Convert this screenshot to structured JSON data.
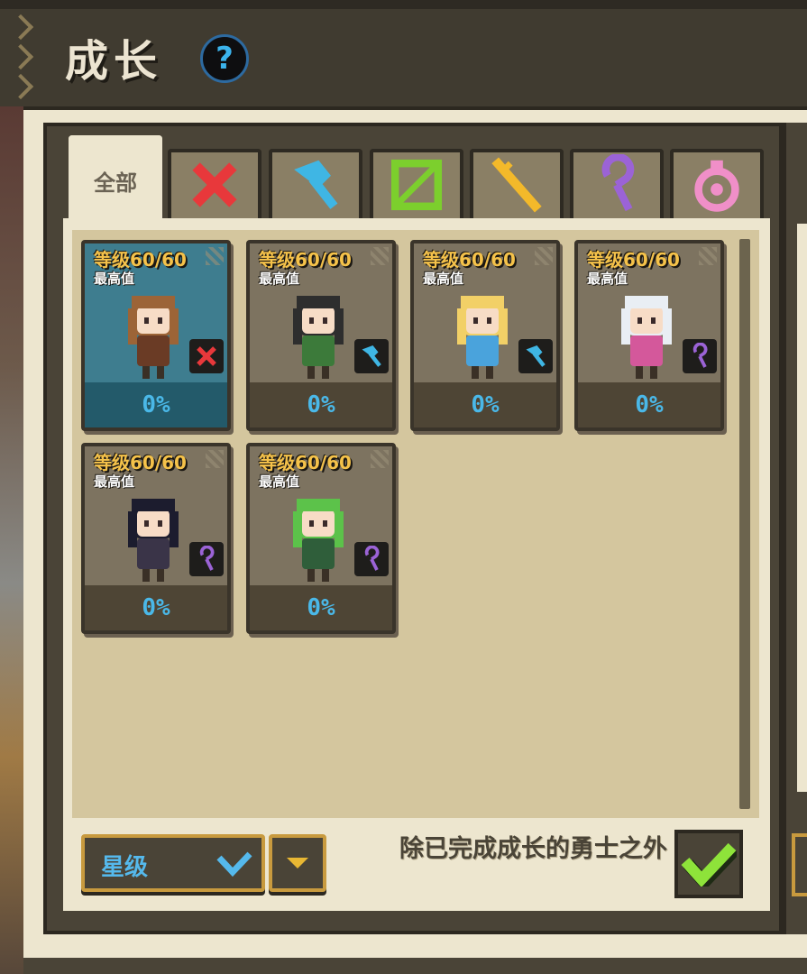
{
  "header": {
    "title": "成长",
    "help_icon_text": "?"
  },
  "tabs": [
    {
      "label": "全部",
      "icon": "all",
      "active": true
    },
    {
      "label": "",
      "icon": "sword-icon",
      "color": "#e8383b"
    },
    {
      "label": "",
      "icon": "axe-icon",
      "color": "#3fb6e4"
    },
    {
      "label": "",
      "icon": "bow-icon",
      "color": "#7ccf2d"
    },
    {
      "label": "",
      "icon": "spear-icon",
      "color": "#f3b92a"
    },
    {
      "label": "",
      "icon": "staff-icon",
      "color": "#9b63d6"
    },
    {
      "label": "",
      "icon": "orb-icon",
      "color": "#f08fc8"
    }
  ],
  "heroes": [
    {
      "level": "等级60/60",
      "max_label": "最高值",
      "progress": "0%",
      "weapon": "sword-icon",
      "weapon_color": "#e8383b",
      "hair": "#9c6437",
      "outfit": "#6a3b25",
      "selected": true
    },
    {
      "level": "等级60/60",
      "max_label": "最高值",
      "progress": "0%",
      "weapon": "axe-icon",
      "weapon_color": "#3fb6e4",
      "hair": "#2e2e2e",
      "outfit": "#3c7a3a",
      "selected": false
    },
    {
      "level": "等级60/60",
      "max_label": "最高值",
      "progress": "0%",
      "weapon": "axe-icon",
      "weapon_color": "#3fb6e4",
      "hair": "#f2d067",
      "outfit": "#4aa3dc",
      "selected": false
    },
    {
      "level": "等级60/60",
      "max_label": "最高值",
      "progress": "0%",
      "weapon": "staff-icon",
      "weapon_color": "#9b63d6",
      "hair": "#e9eef4",
      "outfit": "#d4589b",
      "selected": false
    },
    {
      "level": "等级60/60",
      "max_label": "最高值",
      "progress": "0%",
      "weapon": "staff-icon",
      "weapon_color": "#9b63d6",
      "hair": "#1c1c2e",
      "outfit": "#3a3448",
      "selected": false
    },
    {
      "level": "等级60/60",
      "max_label": "最高值",
      "progress": "0%",
      "weapon": "staff-icon",
      "weapon_color": "#9b63d6",
      "hair": "#5cc24a",
      "outfit": "#2f5e3a",
      "selected": false
    }
  ],
  "sort": {
    "label": "星级",
    "order_icon": "triangle-down-icon"
  },
  "filter": {
    "label": "除已完成成长的勇士之外",
    "checked": true
  },
  "colors": {
    "accent_gold": "#f5c24a",
    "accent_blue": "#4ab8e8",
    "check_green": "#8ee33a"
  }
}
